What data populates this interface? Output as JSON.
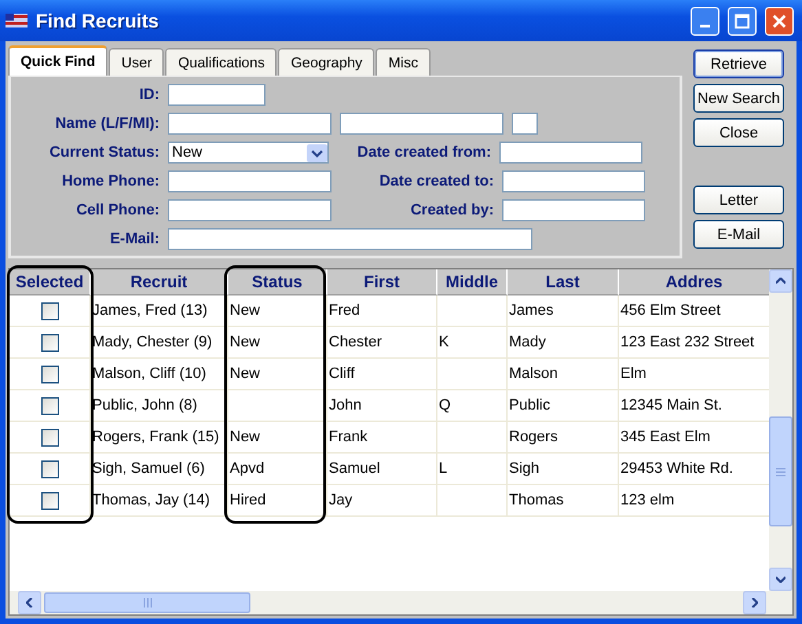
{
  "window": {
    "title": "Find Recruits"
  },
  "tabs": [
    {
      "label": "Quick Find",
      "selected": true
    },
    {
      "label": "User",
      "selected": false
    },
    {
      "label": "Qualifications",
      "selected": false
    },
    {
      "label": "Geography",
      "selected": false
    },
    {
      "label": "Misc",
      "selected": false
    }
  ],
  "form": {
    "id_label": "ID:",
    "name_label": "Name (L/F/MI):",
    "status_label": "Current Status:",
    "status_value": "New",
    "home_phone_label": "Home Phone:",
    "cell_phone_label": "Cell Phone:",
    "email_label": "E-Mail:",
    "date_from_label": "Date created from:",
    "date_to_label": "Date created to:",
    "created_by_label": "Created by:"
  },
  "buttons": [
    {
      "label": "Retrieve",
      "default": true
    },
    {
      "label": "New Search",
      "default": false
    },
    {
      "label": "Close",
      "default": false
    }
  ],
  "extra_buttons": [
    {
      "label": "Letter"
    },
    {
      "label": "E-Mail"
    }
  ],
  "table": {
    "columns": [
      "Selected",
      "Recruit",
      "Status",
      "First",
      "Middle",
      "Last",
      "Addres"
    ],
    "rows": [
      {
        "checked": false,
        "cells": [
          "",
          "James, Fred (13)",
          "New",
          "Fred",
          "",
          "James",
          "456 Elm Street"
        ]
      },
      {
        "checked": false,
        "cells": [
          "",
          "Mady, Chester (9)",
          "New",
          "Chester",
          "K",
          "Mady",
          "123 East 232 Street"
        ]
      },
      {
        "checked": false,
        "cells": [
          "",
          "Malson, Cliff (10)",
          "New",
          "Cliff",
          "",
          "Malson",
          "Elm"
        ]
      },
      {
        "checked": false,
        "cells": [
          "",
          "Public, John (8)",
          "",
          "John",
          "Q",
          "Public",
          "12345 Main St."
        ]
      },
      {
        "checked": false,
        "cells": [
          "",
          "Rogers, Frank (15)",
          "New",
          "Frank",
          "",
          "Rogers",
          "345 East Elm"
        ]
      },
      {
        "checked": false,
        "cells": [
          "",
          "Sigh, Samuel (6)",
          "Apvd",
          "Samuel",
          "L",
          "Sigh",
          "29453 White Rd."
        ]
      },
      {
        "checked": false,
        "cells": [
          "",
          "Thomas, Jay (14)",
          "Hired",
          "Jay",
          "",
          "Thomas",
          "123 elm"
        ]
      }
    ]
  }
}
